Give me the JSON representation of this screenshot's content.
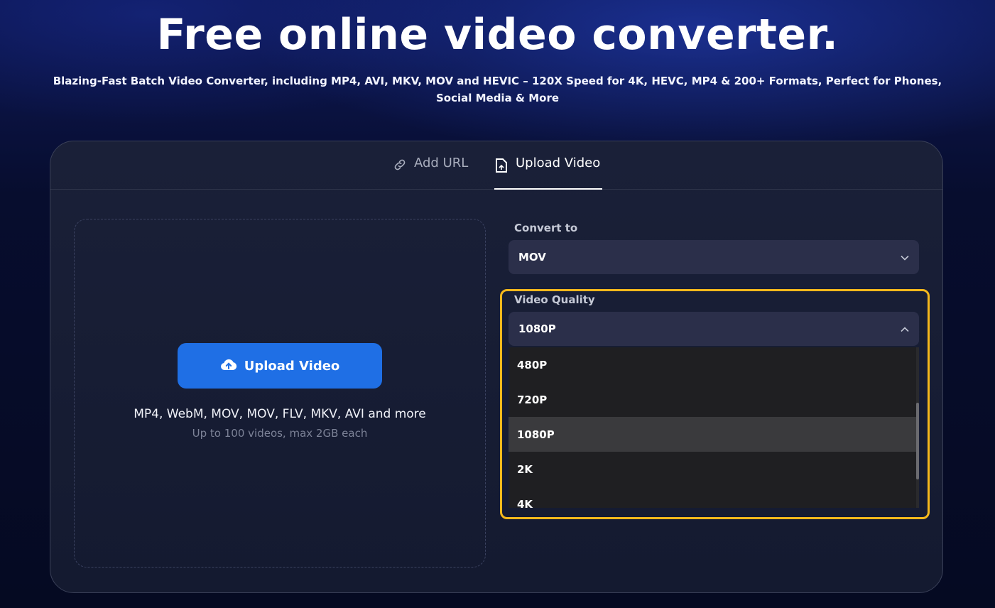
{
  "hero": {
    "title": "Free online video converter.",
    "subtitle": "Blazing-Fast Batch Video Converter, including MP4, AVI, MKV, MOV and HEVIC – 120X Speed for 4K, HEVC, MP4 & 200+ Formats, Perfect for Phones, Social Media & More"
  },
  "tabs": [
    {
      "label": "Add URL",
      "icon": "link-icon",
      "active": false
    },
    {
      "label": "Upload Video",
      "icon": "file-icon",
      "active": true
    }
  ],
  "upload": {
    "button_label": "Upload Video",
    "button_icon": "cloud-upload-icon",
    "formats": "MP4, WebM, MOV, MOV, FLV, MKV, AVI and more",
    "limits": "Up to 100 videos, max 2GB each"
  },
  "convert_to": {
    "label": "Convert to",
    "value": "MOV"
  },
  "video_quality": {
    "label": "Video Quality",
    "value": "1080P",
    "options": [
      "480P",
      "720P",
      "1080P",
      "2K",
      "4K"
    ],
    "selected_index": 2
  },
  "colors": {
    "accent": "#1f6fe5",
    "highlight": "#f5b81c"
  }
}
